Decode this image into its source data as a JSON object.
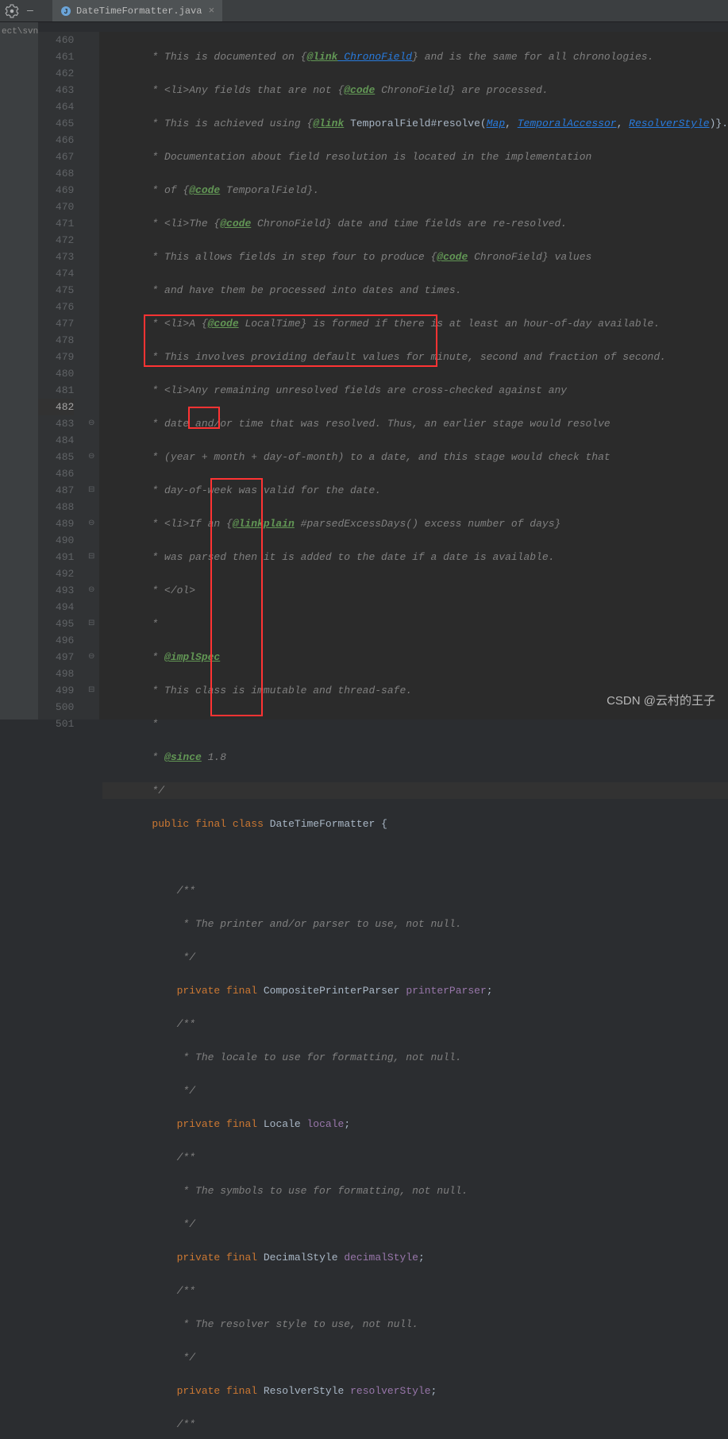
{
  "titlebar": {
    "filename": "DateTimeFormatter.java",
    "project_left": "ect\\svnT"
  },
  "gutter": {
    "start": 460,
    "end": 501,
    "current": 482
  },
  "code": {
    "l460": " * This is documented on {",
    "l460b": "} and is the same for all chronologies.",
    "l460tag": "@link",
    "l460link": " ChronoField",
    "l461": " * <li>Any fields that are not {",
    "l461tag": "@code",
    "l461b": " ChronoField} are processed.",
    "l462": " * This is achieved using {",
    "l462tag": "@link",
    "l462t": " TemporalField",
    "l462m": "#",
    "l462r": "resolve",
    "l462p": "(",
    "l462map": "Map",
    "l462c1": ", ",
    "l462ta": "TemporalAccessor",
    "l462c2": ", ",
    "l462rs": "ResolverStyle",
    "l462e": ")}.",
    "l463": " * Documentation about field resolution is located in the implementation",
    "l464": " * of {",
    "l464tag": "@code",
    "l464b": " TemporalField}.",
    "l465": " * <li>The {",
    "l465tag": "@code",
    "l465b": " ChronoField} date and time fields are re-resolved.",
    "l466": " * This allows fields in step four to produce {",
    "l466tag": "@code",
    "l466b": " ChronoField} values",
    "l467": " * and have them be processed into dates and times.",
    "l468": " * <li>A {",
    "l468tag": "@code",
    "l468b": " LocalTime} is formed if there is at least an hour-of-day available.",
    "l469": " * This involves providing default values for minute, second and fraction of second.",
    "l470": " * <li>Any remaining unresolved fields are cross-checked against any",
    "l471": " * date and/or time that was resolved. Thus, an earlier stage would resolve",
    "l472": " * (year + month + day-of-month) to a date, and this stage would check that",
    "l473": " * day-of-week was valid for the date.",
    "l474": " * <li>If an {",
    "l474tag": "@linkplain",
    "l474b": " #parsedExcessDays() excess number of days}",
    "l475": " * was parsed then it is added to the date if a date is available.",
    "l476": " * </ol>",
    "l477": " *",
    "l478": " * ",
    "l478tag": "@implSpec",
    "l479": " * This class is immutable and thread-safe.",
    "l480": " *",
    "l481": " * ",
    "l481tag": "@since",
    "l481b": " 1.8",
    "l482": " */",
    "l483_public": "public",
    "l483_final": "final",
    "l483_class": "class",
    "l483_name": "DateTimeFormatter",
    "l483_br": " {",
    "l485": "/**",
    "l486": " * The printer and/or parser to use, not null.",
    "l487": " */",
    "l488_p": "private",
    "l488_f": "final",
    "l488_t": "CompositePrinterParser",
    "l488_n": "printerParser",
    "l488_s": ";",
    "l489": "/**",
    "l490": " * The locale to use for formatting, not null.",
    "l491": " */",
    "l492_p": "private",
    "l492_f": "final",
    "l492_t": "Locale",
    "l492_n": "locale",
    "l492_s": ";",
    "l493": "/**",
    "l494": " * The symbols to use for formatting, not null.",
    "l495": " */",
    "l496_p": "private",
    "l496_f": "final",
    "l496_t": "DecimalStyle",
    "l496_n": "decimalStyle",
    "l496_s": ";",
    "l497": "/**",
    "l498": " * The resolver style to use, not null.",
    "l499": " */",
    "l500_p": "private",
    "l500_f": "final",
    "l500_t": "ResolverStyle",
    "l500_n": "resolverStyle",
    "l500_s": ";",
    "l501": "/**"
  },
  "watermark": "CSDN @云村的王子"
}
